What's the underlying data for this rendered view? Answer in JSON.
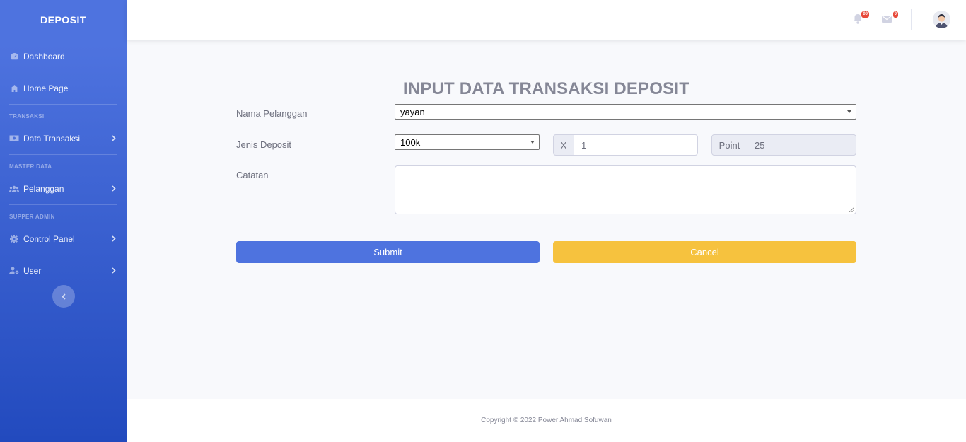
{
  "sidebar": {
    "brand": "DEPOSIT",
    "items": [
      {
        "label": "Dashboard",
        "icon": "tachometer-icon"
      },
      {
        "label": "Home Page",
        "icon": "home-icon"
      }
    ],
    "sections": [
      {
        "heading": "TRANSAKSI",
        "items": [
          {
            "label": "Data Transaksi",
            "icon": "money-bill-icon"
          }
        ]
      },
      {
        "heading": "MASTER DATA",
        "items": [
          {
            "label": "Pelanggan",
            "icon": "users-icon"
          }
        ]
      },
      {
        "heading": "SUPPER ADMIN",
        "items": [
          {
            "label": "Control Panel",
            "icon": "gear-icon"
          },
          {
            "label": "User",
            "icon": "user-cog-icon"
          }
        ]
      }
    ]
  },
  "topbar": {
    "alerts_badge": "00",
    "messages_badge": "0"
  },
  "form": {
    "title": "INPUT DATA TRANSAKSI DEPOSIT",
    "nama_pelanggan_label": "Nama Pelanggan",
    "nama_pelanggan_value": "yayan",
    "jenis_deposit_label": "Jenis Deposit",
    "jenis_deposit_value": "100k",
    "multiplier_addon": "X",
    "multiplier_value": "1",
    "point_addon": "Point",
    "point_value": "25",
    "catatan_label": "Catatan",
    "catatan_value": "",
    "submit_label": "Submit",
    "cancel_label": "Cancel"
  },
  "footer": {
    "copyright": "Copyright © 2022 Power Ahmad Sofuwan"
  },
  "colors": {
    "primary": "#4e73df",
    "warning": "#f6c23e",
    "danger": "#e74a3b"
  }
}
